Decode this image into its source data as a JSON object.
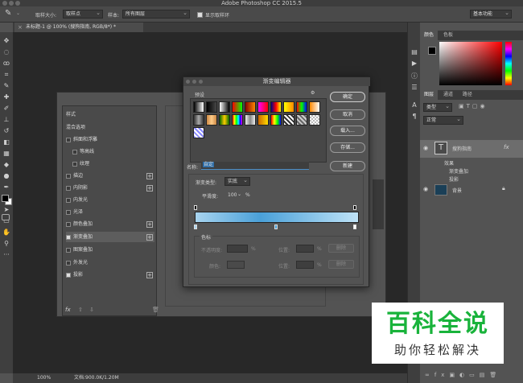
{
  "app": {
    "title": "Adobe Photoshop CC 2015.5"
  },
  "options_bar": {
    "sample_size_label": "取样大小:",
    "sample_size_value": "取样点",
    "sample_label": "样本:",
    "sample_value": "所有图层",
    "show_ring_label": "显示取样环",
    "workspace_value": "基本功能"
  },
  "document": {
    "tab_label": "未标题-1 @ 100% (搜狗指南, RGB/8*) *"
  },
  "status": {
    "zoom": "100%",
    "doc_size": "文档:900.0K/1.20M"
  },
  "color_panel": {
    "tabs": [
      "颜色",
      "色板"
    ]
  },
  "layers_panel": {
    "tabs": [
      "图层",
      "通道",
      "路径"
    ],
    "filter_kind": "类型",
    "blend_mode": "正常",
    "layers": [
      {
        "name": "搜狗指南",
        "fx": "fx",
        "effects_label": "效果",
        "effects": [
          "渐变叠加",
          "投影"
        ]
      },
      {
        "name": "背景"
      }
    ]
  },
  "layer_style": {
    "items": [
      {
        "label": "样式",
        "checkbox": false,
        "plus": false
      },
      {
        "label": "混合选项",
        "checkbox": false,
        "plus": false
      },
      {
        "label": "斜面和浮雕",
        "checkbox": true,
        "checked": false,
        "plus": false
      },
      {
        "label": "等高线",
        "checkbox": true,
        "checked": false,
        "plus": false,
        "indent": true
      },
      {
        "label": "纹理",
        "checkbox": true,
        "checked": false,
        "plus": false,
        "indent": true
      },
      {
        "label": "描边",
        "checkbox": true,
        "checked": false,
        "plus": true
      },
      {
        "label": "内阴影",
        "checkbox": true,
        "checked": false,
        "plus": true
      },
      {
        "label": "内发光",
        "checkbox": true,
        "checked": false,
        "plus": false
      },
      {
        "label": "光泽",
        "checkbox": true,
        "checked": false,
        "plus": false
      },
      {
        "label": "颜色叠加",
        "checkbox": true,
        "checked": false,
        "plus": true
      },
      {
        "label": "渐变叠加",
        "checkbox": true,
        "checked": true,
        "plus": true,
        "selected": true
      },
      {
        "label": "图案叠加",
        "checkbox": true,
        "checked": false,
        "plus": false
      },
      {
        "label": "外发光",
        "checkbox": true,
        "checked": false,
        "plus": false
      },
      {
        "label": "投影",
        "checkbox": true,
        "checked": true,
        "plus": true
      }
    ],
    "footer_fx": "fx"
  },
  "gradient_editor": {
    "title": "渐变编辑器",
    "presets_label": "预设",
    "buttons": {
      "ok": "确定",
      "cancel": "取消",
      "load": "载入...",
      "save": "存储...",
      "new": "新建"
    },
    "name_label": "名称:",
    "name_value": "自定",
    "gradient_type_label": "渐变类型:",
    "gradient_type_value": "实底",
    "smoothness_label": "平滑度:",
    "smoothness_value": "100",
    "smoothness_unit": "%",
    "stops_label": "色标",
    "opacity_label": "不透明度:",
    "opacity_unit": "%",
    "position_label": "位置:",
    "position_unit": "%",
    "delete_label": "删除",
    "color_label": "颜色:",
    "color_position_label": "位置:",
    "color_position_unit": "%",
    "color_delete_label": "删除",
    "gradient_start": "#a8d4ef",
    "gradient_mid": "#4aa0d8",
    "gradient_end": "#bfe3f7"
  },
  "watermark": {
    "title": "百科全说",
    "subtitle": "助你轻松解决"
  }
}
